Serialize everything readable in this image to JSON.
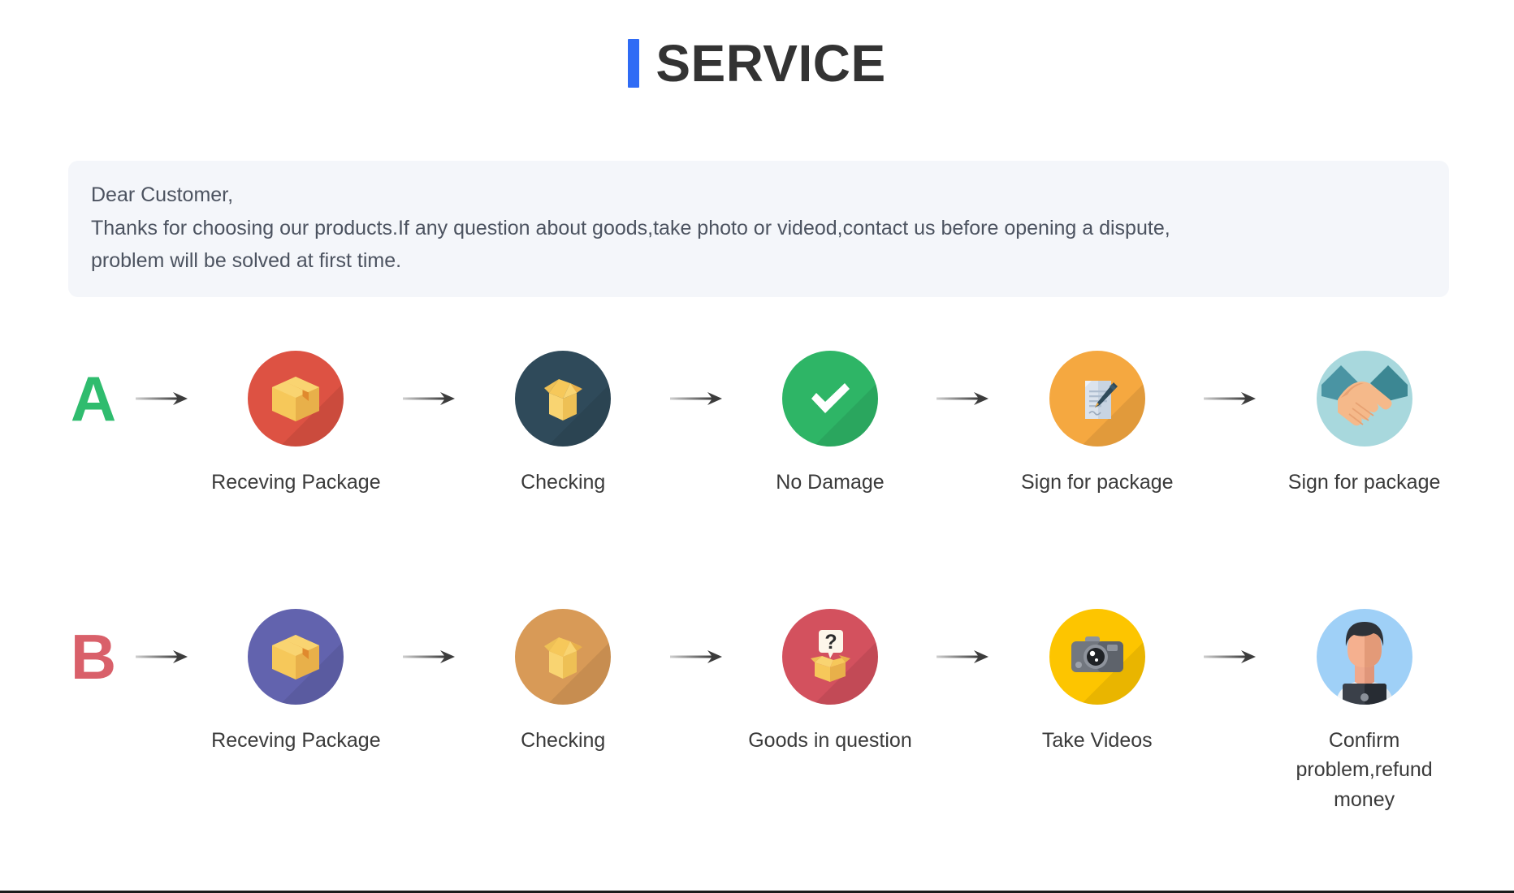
{
  "header": {
    "title": "SERVICE",
    "accent_color": "#2f6bf5"
  },
  "notice": {
    "lines": [
      "Dear Customer,",
      "Thanks for choosing our products.If any question about goods,take photo or videod,contact us before opening a dispute,",
      "problem will be solved at first time."
    ],
    "background_color": "#f4f6fa"
  },
  "flows": [
    {
      "badge": "A",
      "badge_color": "#2fbc6e",
      "steps": [
        {
          "label": "Receving Package",
          "icon": "closed-box-icon",
          "circle_color": "#dd5243"
        },
        {
          "label": "Checking",
          "icon": "open-box-icon",
          "circle_color": "#2f4a5a"
        },
        {
          "label": "No Damage",
          "icon": "checkmark-icon",
          "circle_color": "#2eb566"
        },
        {
          "label": "Sign for package",
          "icon": "document-pen-icon",
          "circle_color": "#f5a840"
        },
        {
          "label": "Sign for package",
          "icon": "handshake-icon",
          "circle_color": "#a8d8dd"
        }
      ]
    },
    {
      "badge": "B",
      "badge_color": "#d9606a",
      "steps": [
        {
          "label": "Receving Package",
          "icon": "closed-box-icon",
          "circle_color": "#6263ae"
        },
        {
          "label": "Checking",
          "icon": "open-box-icon",
          "circle_color": "#d89a57"
        },
        {
          "label": "Goods in question",
          "icon": "question-box-icon",
          "circle_color": "#d3515e"
        },
        {
          "label": "Take Videos",
          "icon": "camera-icon",
          "circle_color": "#fdc500"
        },
        {
          "label": "Confirm problem,refund money",
          "icon": "support-person-icon",
          "circle_color": "#9fd0f7"
        }
      ]
    }
  ],
  "arrow": {
    "icon": "arrow-right-icon",
    "color": "#4a4a4a"
  }
}
